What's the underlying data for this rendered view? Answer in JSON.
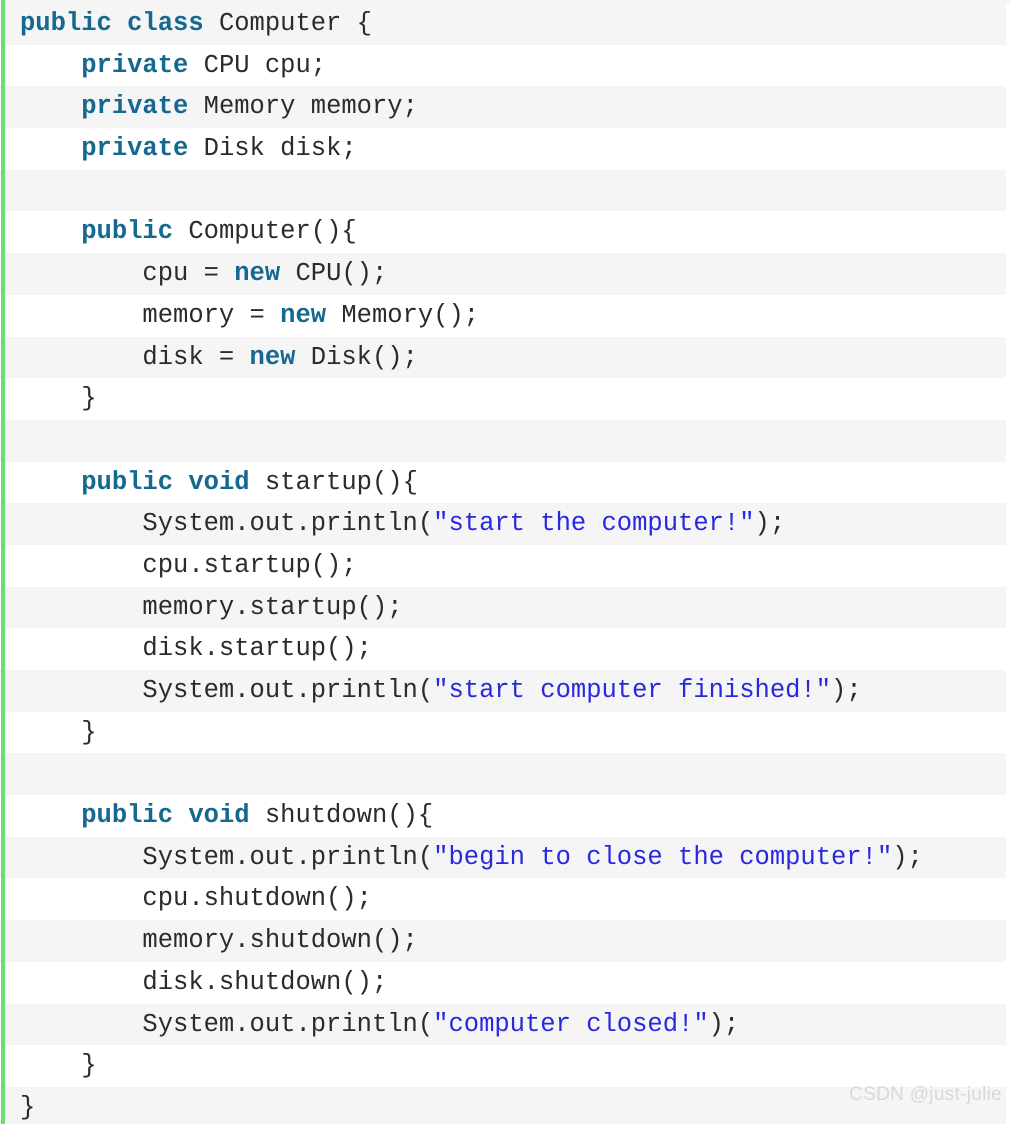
{
  "code_block": {
    "language": "java",
    "accent_color": "#6bdd72",
    "stripe_color": "#f5f5f5",
    "background_color": "#ffffff",
    "keyword_color": "#15688f",
    "string_color": "#2828e0",
    "text_color": "#2b2b2b",
    "watermark": "CSDN @just-julie",
    "watermark_color": "#d8d8d8",
    "lines": [
      {
        "n": 1,
        "plain": "public class Computer {",
        "tokens": [
          {
            "t": "public class",
            "k": "kw"
          },
          {
            "t": " Computer {",
            "k": "pl"
          }
        ]
      },
      {
        "n": 2,
        "plain": "    private CPU cpu;",
        "tokens": [
          {
            "t": "    ",
            "k": "pl"
          },
          {
            "t": "private",
            "k": "kw"
          },
          {
            "t": " CPU cpu;",
            "k": "pl"
          }
        ]
      },
      {
        "n": 3,
        "plain": "    private Memory memory;",
        "tokens": [
          {
            "t": "    ",
            "k": "pl"
          },
          {
            "t": "private",
            "k": "kw"
          },
          {
            "t": " Memory memory;",
            "k": "pl"
          }
        ]
      },
      {
        "n": 4,
        "plain": "    private Disk disk;",
        "tokens": [
          {
            "t": "    ",
            "k": "pl"
          },
          {
            "t": "private",
            "k": "kw"
          },
          {
            "t": " Disk disk;",
            "k": "pl"
          }
        ]
      },
      {
        "n": 5,
        "plain": "",
        "tokens": []
      },
      {
        "n": 6,
        "plain": "    public Computer(){",
        "tokens": [
          {
            "t": "    ",
            "k": "pl"
          },
          {
            "t": "public",
            "k": "kw"
          },
          {
            "t": " Computer(){",
            "k": "pl"
          }
        ]
      },
      {
        "n": 7,
        "plain": "        cpu = new CPU();",
        "tokens": [
          {
            "t": "        cpu = ",
            "k": "pl"
          },
          {
            "t": "new",
            "k": "kw"
          },
          {
            "t": " CPU();",
            "k": "pl"
          }
        ]
      },
      {
        "n": 8,
        "plain": "        memory = new Memory();",
        "tokens": [
          {
            "t": "        memory = ",
            "k": "pl"
          },
          {
            "t": "new",
            "k": "kw"
          },
          {
            "t": " Memory();",
            "k": "pl"
          }
        ]
      },
      {
        "n": 9,
        "plain": "        disk = new Disk();",
        "tokens": [
          {
            "t": "        disk = ",
            "k": "pl"
          },
          {
            "t": "new",
            "k": "kw"
          },
          {
            "t": " Disk();",
            "k": "pl"
          }
        ]
      },
      {
        "n": 10,
        "plain": "    }",
        "tokens": [
          {
            "t": "    }",
            "k": "pl"
          }
        ]
      },
      {
        "n": 11,
        "plain": "",
        "tokens": []
      },
      {
        "n": 12,
        "plain": "    public void startup(){",
        "tokens": [
          {
            "t": "    ",
            "k": "pl"
          },
          {
            "t": "public void",
            "k": "kw"
          },
          {
            "t": " startup(){",
            "k": "pl"
          }
        ]
      },
      {
        "n": 13,
        "plain": "        System.out.println(\"start the computer!\");",
        "tokens": [
          {
            "t": "        System.out.println(",
            "k": "pl"
          },
          {
            "t": "\"start the computer!\"",
            "k": "str"
          },
          {
            "t": ");",
            "k": "pl"
          }
        ]
      },
      {
        "n": 14,
        "plain": "        cpu.startup();",
        "tokens": [
          {
            "t": "        cpu.startup();",
            "k": "pl"
          }
        ]
      },
      {
        "n": 15,
        "plain": "        memory.startup();",
        "tokens": [
          {
            "t": "        memory.startup();",
            "k": "pl"
          }
        ]
      },
      {
        "n": 16,
        "plain": "        disk.startup();",
        "tokens": [
          {
            "t": "        disk.startup();",
            "k": "pl"
          }
        ]
      },
      {
        "n": 17,
        "plain": "        System.out.println(\"start computer finished!\");",
        "tokens": [
          {
            "t": "        System.out.println(",
            "k": "pl"
          },
          {
            "t": "\"start computer finished!\"",
            "k": "str"
          },
          {
            "t": ");",
            "k": "pl"
          }
        ]
      },
      {
        "n": 18,
        "plain": "    }",
        "tokens": [
          {
            "t": "    }",
            "k": "pl"
          }
        ]
      },
      {
        "n": 19,
        "plain": "",
        "tokens": []
      },
      {
        "n": 20,
        "plain": "    public void shutdown(){",
        "tokens": [
          {
            "t": "    ",
            "k": "pl"
          },
          {
            "t": "public void",
            "k": "kw"
          },
          {
            "t": " shutdown(){",
            "k": "pl"
          }
        ]
      },
      {
        "n": 21,
        "plain": "        System.out.println(\"begin to close the computer!\");",
        "tokens": [
          {
            "t": "        System.out.println(",
            "k": "pl"
          },
          {
            "t": "\"begin to close the computer!\"",
            "k": "str"
          },
          {
            "t": ");",
            "k": "pl"
          }
        ]
      },
      {
        "n": 22,
        "plain": "        cpu.shutdown();",
        "tokens": [
          {
            "t": "        cpu.shutdown();",
            "k": "pl"
          }
        ]
      },
      {
        "n": 23,
        "plain": "        memory.shutdown();",
        "tokens": [
          {
            "t": "        memory.shutdown();",
            "k": "pl"
          }
        ]
      },
      {
        "n": 24,
        "plain": "        disk.shutdown();",
        "tokens": [
          {
            "t": "        disk.shutdown();",
            "k": "pl"
          }
        ]
      },
      {
        "n": 25,
        "plain": "        System.out.println(\"computer closed!\");",
        "tokens": [
          {
            "t": "        System.out.println(",
            "k": "pl"
          },
          {
            "t": "\"computer closed!\"",
            "k": "str"
          },
          {
            "t": ");",
            "k": "pl"
          }
        ]
      },
      {
        "n": 26,
        "plain": "    }",
        "tokens": [
          {
            "t": "    }",
            "k": "pl"
          }
        ]
      },
      {
        "n": 27,
        "plain": "}",
        "tokens": [
          {
            "t": "}",
            "k": "pl"
          }
        ]
      }
    ]
  }
}
